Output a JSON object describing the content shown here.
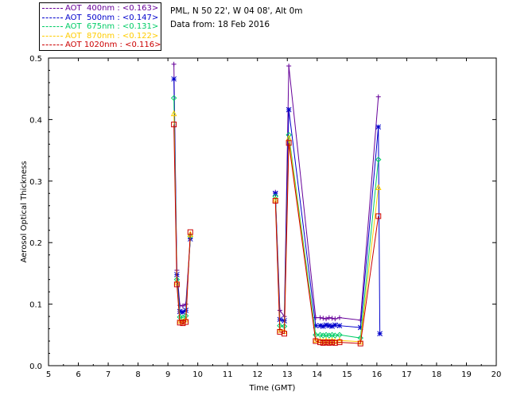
{
  "station_name": "PML, N 50 22', W 04 08', Alt 0m",
  "data_date": "Data from: 18 Feb 2016",
  "legend": [
    {
      "label": "AOT  400nm : <0.163>",
      "color": "#660099"
    },
    {
      "label": "AOT  500nm : <0.147>",
      "color": "#0000cc"
    },
    {
      "label": "AOT  675nm : <0.131>",
      "color": "#00cc66"
    },
    {
      "label": "AOT  870nm : <0.122>",
      "color": "#ffcc00"
    },
    {
      "label": "AOT 1020nm : <0.116>",
      "color": "#cc0000"
    }
  ],
  "chart_data": {
    "type": "scatter",
    "xlabel": "Time (GMT)",
    "ylabel": "Aerosol Optical Thickness",
    "xlim": [
      5,
      20
    ],
    "ylim": [
      0.0,
      0.5
    ],
    "xticks": [
      5,
      6,
      7,
      8,
      9,
      10,
      11,
      12,
      13,
      14,
      15,
      16,
      17,
      18,
      19,
      20
    ],
    "yticks": [
      0.0,
      0.1,
      0.2,
      0.3,
      0.4,
      0.5
    ],
    "ytick_labels": [
      "0.0",
      "0.1",
      "0.2",
      "0.3",
      "0.4",
      "0.5"
    ],
    "grid": false,
    "legend_position": "top-left",
    "series": [
      {
        "name": "AOT  400nm : <0.163>",
        "color": "#660099",
        "marker": "plus",
        "x": [
          9.2,
          9.3,
          9.4,
          9.5,
          9.6,
          9.75,
          12.6,
          12.75,
          12.9,
          13.05,
          13.95,
          14.1,
          14.2,
          14.3,
          14.4,
          14.5,
          14.6,
          14.75,
          15.45,
          16.05
        ],
        "y": [
          0.49,
          0.155,
          0.098,
          0.097,
          0.1,
          0.207,
          0.282,
          0.09,
          0.08,
          0.487,
          0.078,
          0.078,
          0.077,
          0.076,
          0.078,
          0.077,
          0.076,
          0.078,
          0.074,
          0.437
        ]
      },
      {
        "name": "AOT  500nm : <0.147>",
        "color": "#0000cc",
        "marker": "star",
        "x": [
          9.2,
          9.3,
          9.4,
          9.5,
          9.6,
          9.75,
          12.6,
          12.75,
          12.9,
          13.05,
          13.95,
          14.1,
          14.2,
          14.3,
          14.4,
          14.5,
          14.6,
          14.75,
          15.45,
          16.05,
          16.1
        ],
        "y": [
          0.466,
          0.148,
          0.088,
          0.087,
          0.09,
          0.206,
          0.28,
          0.075,
          0.073,
          0.416,
          0.065,
          0.065,
          0.064,
          0.066,
          0.065,
          0.064,
          0.066,
          0.065,
          0.062,
          0.388,
          0.052
        ]
      },
      {
        "name": "AOT  675nm : <0.131>",
        "color": "#00cc66",
        "marker": "diamond",
        "x": [
          9.2,
          9.3,
          9.4,
          9.5,
          9.6,
          9.75,
          12.6,
          12.75,
          12.9,
          13.05,
          13.95,
          14.1,
          14.2,
          14.3,
          14.4,
          14.5,
          14.6,
          14.75,
          15.45,
          16.05
        ],
        "y": [
          0.435,
          0.14,
          0.079,
          0.078,
          0.081,
          0.21,
          0.275,
          0.065,
          0.064,
          0.375,
          0.05,
          0.05,
          0.049,
          0.05,
          0.049,
          0.05,
          0.049,
          0.05,
          0.045,
          0.335
        ]
      },
      {
        "name": "AOT  870nm : <0.122>",
        "color": "#ffcc00",
        "marker": "triangle",
        "x": [
          9.2,
          9.3,
          9.4,
          9.5,
          9.6,
          9.75,
          12.6,
          12.75,
          12.9,
          13.05,
          13.95,
          14.1,
          14.2,
          14.3,
          14.4,
          14.5,
          14.6,
          14.75,
          15.45,
          16.05
        ],
        "y": [
          0.41,
          0.135,
          0.073,
          0.072,
          0.075,
          0.214,
          0.27,
          0.058,
          0.056,
          0.37,
          0.042,
          0.041,
          0.04,
          0.041,
          0.04,
          0.041,
          0.04,
          0.041,
          0.039,
          0.29
        ]
      },
      {
        "name": "AOT 1020nm : <0.116>",
        "color": "#cc0000",
        "marker": "square",
        "x": [
          9.2,
          9.3,
          9.4,
          9.5,
          9.6,
          9.75,
          12.6,
          12.75,
          12.9,
          13.05,
          13.95,
          14.1,
          14.2,
          14.3,
          14.4,
          14.5,
          14.6,
          14.75,
          15.45,
          16.05
        ],
        "y": [
          0.392,
          0.132,
          0.07,
          0.069,
          0.071,
          0.217,
          0.268,
          0.055,
          0.052,
          0.362,
          0.04,
          0.038,
          0.037,
          0.038,
          0.037,
          0.038,
          0.037,
          0.038,
          0.036,
          0.243
        ]
      }
    ]
  }
}
